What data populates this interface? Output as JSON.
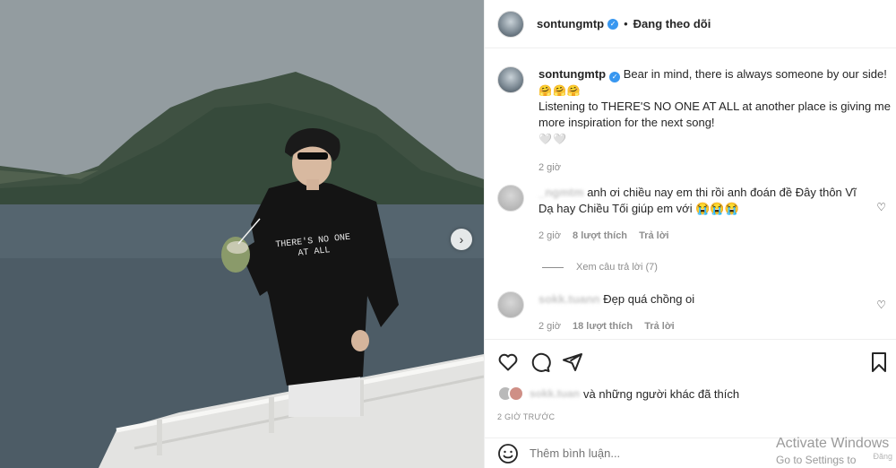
{
  "post": {
    "username": "sontungmtp",
    "follow_status": "Đang theo dõi",
    "caption_line1": "Bear in mind, there is always someone by our side!",
    "caption_emojis": "🤗🤗🤗",
    "caption_line2": "Listening to THERE'S NO ONE AT ALL at another place is giving me more inspiration for the next song!",
    "caption_emojis2": "🤍🤍",
    "time": "2 giờ",
    "shirt_text": "THERE'S NO ONE AT ALL"
  },
  "comments": [
    {
      "username": "_ngmtm",
      "text": "anh ơi chiều nay em thi rồi anh đoán đề Đây thôn Vĩ Dạ hay Chiều Tối giúp em với 😭😭😭",
      "time": "2 giờ",
      "likes": "8 lượt thích",
      "reply": "Trả lời"
    },
    {
      "username": "sokk.tuann",
      "text": "Đẹp quá chồng oi",
      "time": "2 giờ",
      "likes": "18 lượt thích",
      "reply": "Trả lời"
    }
  ],
  "view_replies": "Xem câu trả lời (7)",
  "likes_summary": {
    "username": "sokk.tuan",
    "text": "và những người khác đã thích"
  },
  "time_ago": "2 GIỜ TRƯỚC",
  "add_comment_placeholder": "Thêm bình luận...",
  "watermark": {
    "line1": "Activate Windows",
    "line2": "Go to Settings to activate Windows.",
    "small": "Đăng"
  },
  "colors": {
    "verified": "#3897f0",
    "text": "#262626",
    "muted": "#8e8e8e"
  }
}
